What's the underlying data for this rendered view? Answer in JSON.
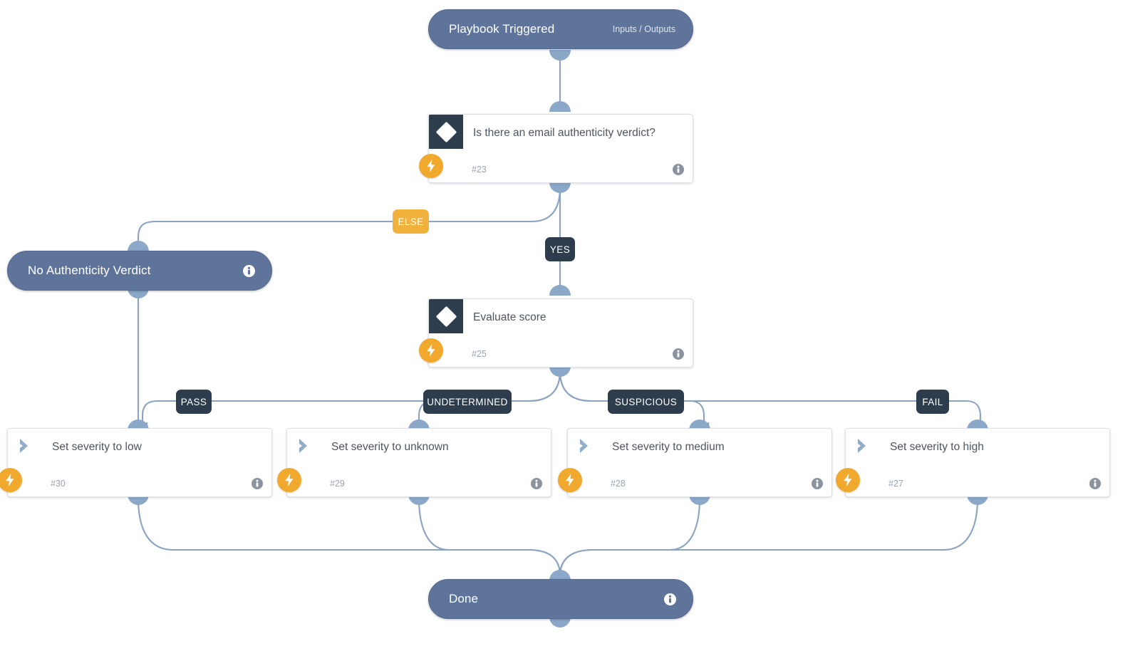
{
  "diagram": {
    "type": "playbook-workflow",
    "colors": {
      "node_pill": "#5f749b",
      "card_background": "#ffffff",
      "glyph_box": "#2e3d4e",
      "bolt_badge": "#f0a92c",
      "edge": "#8ba3c1",
      "label_dark": "#2e3d4e",
      "label_amber": "#f0b23c",
      "card_title_text": "#4c5560",
      "card_id_text": "#9aa3ad"
    },
    "nodes": {
      "trigger": {
        "title": "Playbook Triggered",
        "right_label": "Inputs / Outputs",
        "kind": "pill"
      },
      "decision_auth": {
        "title": "Is there an email authenticity verdict?",
        "id": "#23",
        "kind": "condition",
        "glyph": "diamond-icon",
        "badge": "lightning-bolt-icon"
      },
      "no_verdict": {
        "title": "No Authenticity Verdict",
        "kind": "pill"
      },
      "evaluate_score": {
        "title": "Evaluate score",
        "id": "#25",
        "kind": "condition",
        "glyph": "diamond-icon",
        "badge": "lightning-bolt-icon"
      },
      "sev_low": {
        "title": "Set severity to low",
        "id": "#30",
        "kind": "action",
        "glyph": "chevron-right-icon",
        "badge": "lightning-bolt-icon"
      },
      "sev_unknown": {
        "title": "Set severity to unknown",
        "id": "#29",
        "kind": "action",
        "glyph": "chevron-right-icon",
        "badge": "lightning-bolt-icon"
      },
      "sev_medium": {
        "title": "Set severity to medium",
        "id": "#28",
        "kind": "action",
        "glyph": "chevron-right-icon",
        "badge": "lightning-bolt-icon"
      },
      "sev_high": {
        "title": "Set severity to high",
        "id": "#27",
        "kind": "action",
        "glyph": "chevron-right-icon",
        "badge": "lightning-bolt-icon"
      },
      "done": {
        "title": "Done",
        "kind": "pill"
      }
    },
    "branch_labels": {
      "else": "ELSE",
      "yes": "YES",
      "pass": "PASS",
      "undetermined": "UNDETERMINED",
      "suspicious": "SUSPICIOUS",
      "fail": "FAIL"
    }
  }
}
